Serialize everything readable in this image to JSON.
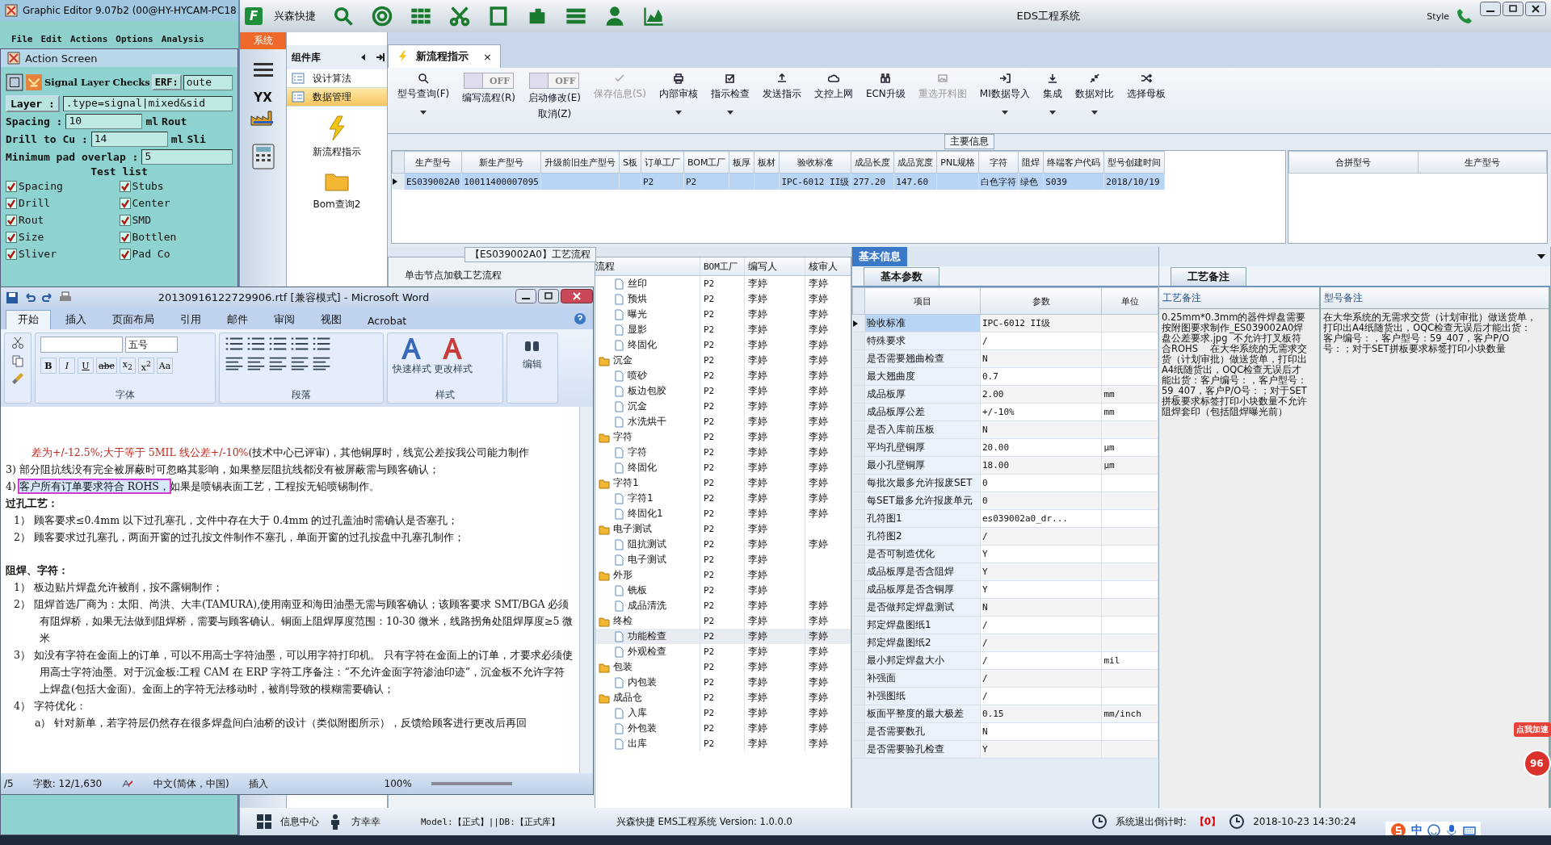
{
  "graphic_editor": {
    "title": "Graphic Editor 9.07b2 (00@HY-HYCAM-PC18",
    "menu": [
      "File",
      "Edit",
      "Actions",
      "Options",
      "Analysis"
    ]
  },
  "action_screen": {
    "title": "Action Screen",
    "heading": "Signal Layer Checks",
    "erf_label": "ERF:",
    "erf_value": "oute",
    "layer_label": "Layer :",
    "layer_value": ".type=signal|mixed&sid",
    "params": [
      {
        "label": "Spacing     :",
        "value": "10",
        "unit": "ml",
        "extra": "Rout"
      },
      {
        "label": "Drill to Cu :",
        "value": "14",
        "unit": "ml",
        "extra": "Sli"
      },
      {
        "label": "Minimum pad overlap :",
        "value": "5"
      }
    ],
    "test_list_title": "Test list",
    "tests": [
      {
        "label": "Spacing",
        "checked": true
      },
      {
        "label": "Stubs",
        "checked": true
      },
      {
        "label": "Drill",
        "checked": true
      },
      {
        "label": "Center",
        "checked": true
      },
      {
        "label": "Rout",
        "checked": true
      },
      {
        "label": "SMD",
        "checked": true
      },
      {
        "label": "Size",
        "checked": true
      },
      {
        "label": "Bottlen",
        "checked": true
      },
      {
        "label": "Sliver",
        "checked": true
      },
      {
        "label": "Pad Co",
        "checked": true
      }
    ]
  },
  "eds": {
    "logo_letter": "F",
    "app_name": "兴森快捷",
    "title": "EDS工程系统",
    "style_menu": "Style",
    "nav": {
      "system_tab": "系统",
      "logo_text": "YX"
    },
    "components": {
      "title": "组件库",
      "items": [
        {
          "label": "设计算法",
          "selected": false
        },
        {
          "label": "数据管理",
          "selected": true
        }
      ],
      "tools": [
        "新流程指示",
        "Bom查询2"
      ]
    },
    "tab": {
      "label": "新流程指示",
      "close": "×"
    },
    "ribbon": [
      {
        "kind": "button",
        "label": "型号查询(F)",
        "disabled": false,
        "dropdown": true
      },
      {
        "kind": "toggle",
        "label": "编写流程(R)",
        "toggle_text": "OFF",
        "on": false
      },
      {
        "kind": "toggle",
        "label": "启动修改(E)",
        "label2": "取消(Z)",
        "toggle_text": "OFF",
        "on": false
      },
      {
        "kind": "button",
        "label": "保存信息(S)",
        "disabled": true,
        "dropdown": false
      },
      {
        "kind": "button",
        "label": "内部审核",
        "disabled": false,
        "dropdown": true
      },
      {
        "kind": "button",
        "label": "指示检查",
        "disabled": false,
        "dropdown": true
      },
      {
        "kind": "button",
        "label": "发送指示",
        "disabled": false,
        "dropdown": false
      },
      {
        "kind": "button",
        "label": "文控上网",
        "disabled": false,
        "dropdown": false
      },
      {
        "kind": "button",
        "label": "ECN升级",
        "disabled": false,
        "dropdown": false
      },
      {
        "kind": "button",
        "label": "重选开料图",
        "disabled": true,
        "dropdown": false
      },
      {
        "kind": "button",
        "label": "MI数据导入",
        "disabled": false,
        "dropdown": true
      },
      {
        "kind": "button",
        "label": "集成",
        "disabled": false,
        "dropdown": true
      },
      {
        "kind": "button",
        "label": "数据对比",
        "disabled": false,
        "dropdown": true
      },
      {
        "kind": "button",
        "label": "选择母板",
        "disabled": false,
        "dropdown": false
      }
    ],
    "main_info": {
      "title": "主要信息",
      "columns": [
        "生产型号",
        "新生产型号",
        "升级前旧生产型号",
        "S板",
        "订单工厂",
        "BOM工厂",
        "板厚",
        "板材",
        "验收标准",
        "成品长度",
        "成品宽度",
        "PNL规格",
        "字符",
        "阻焊",
        "终端客户代码",
        "型号创建时间"
      ],
      "rows": [
        {
          "selected": true,
          "cells": [
            "ES039002A0",
            "10011400007095",
            null,
            null,
            "P2",
            "P2",
            null,
            null,
            "IPC-6012 II级",
            "277.20",
            "147.60",
            null,
            "白色字符",
            "绿色",
            "S039",
            "2018/10/19"
          ]
        }
      ],
      "side_columns": [
        "合拼型号",
        "生产型号"
      ]
    },
    "process": {
      "title": "【ES039002A0】工艺流程",
      "hint": "单击节点加载工艺流程",
      "columns": [
        "流程",
        "BOM工厂",
        "编写人",
        "核审人"
      ],
      "tree": [
        {
          "children": [
            {
              "name": "丝印",
              "bom": "P2",
              "writer": "李婷",
              "reviewer": "李婷",
              "selected": false
            },
            {
              "name": "预烘",
              "bom": "P2",
              "writer": "李婷",
              "reviewer": "李婷",
              "selected": false
            },
            {
              "name": "曝光",
              "bom": "P2",
              "writer": "李婷",
              "reviewer": "李婷",
              "selected": false
            },
            {
              "name": "显影",
              "bom": "P2",
              "writer": "李婷",
              "reviewer": "李婷",
              "selected": false
            },
            {
              "name": "终固化",
              "bom": "P2",
              "writer": "李婷",
              "reviewer": "李婷",
              "selected": false
            }
          ]
        },
        {
          "name": "沉金",
          "bom": "P2",
          "writer": "李婷",
          "reviewer": "李婷",
          "selected": false,
          "children": [
            {
              "name": "喷砂",
              "bom": "P2",
              "writer": "李婷",
              "reviewer": "李婷",
              "selected": false
            },
            {
              "name": "板边包胶",
              "bom": "P2",
              "writer": "李婷",
              "reviewer": "李婷",
              "selected": false
            },
            {
              "name": "沉金",
              "bom": "P2",
              "writer": "李婷",
              "reviewer": "李婷",
              "selected": false
            },
            {
              "name": "水洗烘干",
              "bom": "P2",
              "writer": "李婷",
              "reviewer": "李婷",
              "selected": false
            }
          ]
        },
        {
          "name": "字符",
          "bom": "P2",
          "writer": "李婷",
          "reviewer": "李婷",
          "selected": false,
          "children": [
            {
              "name": "字符",
              "bom": "P2",
              "writer": "李婷",
              "reviewer": "李婷",
              "selected": false
            },
            {
              "name": "终固化",
              "bom": "P2",
              "writer": "李婷",
              "reviewer": "李婷",
              "selected": false
            }
          ]
        },
        {
          "name": "字符1",
          "bom": "P2",
          "writer": "李婷",
          "reviewer": "李婷",
          "selected": false,
          "children": [
            {
              "name": "字符1",
              "bom": "P2",
              "writer": "李婷",
              "reviewer": "李婷",
              "selected": false
            },
            {
              "name": "终固化1",
              "bom": "P2",
              "writer": "李婷",
              "reviewer": "李婷",
              "selected": false
            }
          ]
        },
        {
          "name": "电子测试",
          "bom": "P2",
          "writer": "李婷",
          "selected": false,
          "children": [
            {
              "name": "阻抗测试",
              "bom": "P2",
              "writer": "李婷",
              "reviewer": "李婷",
              "selected": false
            },
            {
              "name": "电子测试",
              "bom": "P2",
              "writer": "李婷",
              "selected": false
            }
          ]
        },
        {
          "name": "外形",
          "bom": "P2",
          "writer": "李婷",
          "selected": false,
          "children": [
            {
              "name": "铣板",
              "bom": "P2",
              "writer": "李婷",
              "selected": false
            },
            {
              "name": "成品清洗",
              "bom": "P2",
              "writer": "李婷",
              "reviewer": "李婷",
              "selected": false
            }
          ]
        },
        {
          "name": "终检",
          "bom": "P2",
          "writer": "李婷",
          "reviewer": "李婷",
          "selected": false,
          "children": [
            {
              "name": "功能检查",
              "bom": "P2",
              "writer": "李婷",
              "reviewer": "李婷",
              "selected": true
            },
            {
              "name": "外观检查",
              "bom": "P2",
              "writer": "李婷",
              "reviewer": "李婷",
              "selected": false
            }
          ]
        },
        {
          "name": "包装",
          "bom": "P2",
          "writer": "李婷",
          "reviewer": "李婷",
          "selected": false,
          "children": [
            {
              "name": "内包装",
              "bom": "P2",
              "writer": "李婷",
              "reviewer": "李婷",
              "selected": false
            }
          ]
        },
        {
          "name": "成品仓",
          "bom": "P2",
          "writer": "李婷",
          "reviewer": "李婷",
          "selected": false,
          "children": [
            {
              "name": "入库",
              "bom": "P2",
              "writer": "李婷",
              "reviewer": "李婷",
              "selected": false
            },
            {
              "name": "外包装",
              "bom": "P2",
              "writer": "李婷",
              "reviewer": "李婷",
              "selected": false
            },
            {
              "name": "出库",
              "bom": "P2",
              "writer": "李婷",
              "reviewer": "李婷",
              "selected": false
            }
          ]
        }
      ]
    },
    "basic_info": {
      "tab": "基本信息",
      "subtab": "基本参数",
      "columns": [
        "项目",
        "参数",
        "单位"
      ],
      "rows": [
        {
          "item": "验收标准",
          "value": "IPC-6012 II级",
          "selected": true
        },
        {
          "item": "特殊要求",
          "value": "/",
          "selected": false
        },
        {
          "item": "是否需要翘曲检查",
          "value": "N",
          "selected": false
        },
        {
          "item": "最大翘曲度",
          "value": "0.7",
          "selected": false
        },
        {
          "item": "成品板厚",
          "value": "2.00",
          "unit": "mm",
          "selected": false
        },
        {
          "item": "成品板厚公差",
          "value": "+/-10%",
          "unit": "mm",
          "selected": false
        },
        {
          "item": "是否入库前压板",
          "value": "N",
          "selected": false
        },
        {
          "item": "平均孔壁铜厚",
          "value": "20.00",
          "unit": "μm",
          "selected": false
        },
        {
          "item": "最小孔壁铜厚",
          "value": "18.00",
          "unit": "μm",
          "selected": false
        },
        {
          "item": "每批次最多允许报废SET",
          "value": "0",
          "selected": false
        },
        {
          "item": "每SET最多允许报废单元",
          "value": "0",
          "selected": false
        },
        {
          "item": "孔符图1",
          "value": "es039002a0_dr...",
          "selected": false
        },
        {
          "item": "孔符图2",
          "value": "/",
          "selected": false
        },
        {
          "item": "是否可制造优化",
          "value": "Y",
          "selected": false
        },
        {
          "item": "成品板厚是否含阻焊",
          "value": "Y",
          "selected": false
        },
        {
          "item": "成品板厚是否含铜厚",
          "value": "Y",
          "selected": false
        },
        {
          "item": "是否做邦定焊盘测试",
          "value": "N",
          "selected": false
        },
        {
          "item": "邦定焊盘图纸1",
          "value": "/",
          "selected": false
        },
        {
          "item": "邦定焊盘图纸2",
          "value": "/",
          "selected": false
        },
        {
          "item": "最小邦定焊盘大小",
          "value": "/",
          "unit": "mil",
          "selected": false
        },
        {
          "item": "补强面",
          "value": "/",
          "selected": false
        },
        {
          "item": "补强图纸",
          "value": "/",
          "selected": false
        },
        {
          "item": "板面平整度的最大极差",
          "value": "0.15",
          "unit": "mm/inch",
          "selected": false
        },
        {
          "item": "是否需要数孔",
          "value": "N",
          "selected": false
        },
        {
          "item": "是否需要验孔检查",
          "value": "Y",
          "selected": false
        }
      ]
    },
    "notes": {
      "subtab": "工艺备注",
      "columns": [
        "工艺备注",
        "型号备注"
      ],
      "process_note": "0.25mm*0.3mm的器件焊盘需要按附图要求制作_ES039002A0焊盘公差要求.jpg  不允许打叉板符合ROHS    在大华系统的无需求交货（计划审批）做送货单，打印出A4纸随货出，OQC检查无误后才能出货：客户编号：，客户型号：59_407，客户P/O号：；对于SET拼板要求标签打印小块数量不允许阻焊套印（包括阻焊曝光前）",
      "model_note": "在大华系统的无需求交货（计划审批）做送货单，打印出A4纸随货出，OQC检查无误后才能出货：客户编号：，客户型号：59_407，客户P/O号：；对于SET拼板要求标签打印小块数量"
    },
    "status": {
      "info_center": "信息中心",
      "user": "方幸幸",
      "model": "Model:【正式】||DB:【正式库】",
      "version": "兴森快捷  EMS工程系统  Version: 1.0.0.0",
      "countdown_label": "系统退出倒计时:",
      "countdown": "【0】",
      "time": "2018-10-23 14:30:24"
    }
  },
  "word": {
    "title": "20130916122729906.rtf [兼容模式] - Microsoft Word",
    "tabs": [
      {
        "label": "开始",
        "selected": true
      },
      {
        "label": "插入",
        "selected": false
      },
      {
        "label": "页面布局",
        "selected": false
      },
      {
        "label": "引用",
        "selected": false
      },
      {
        "label": "邮件",
        "selected": false
      },
      {
        "label": "审阅",
        "selected": false
      },
      {
        "label": "视图",
        "selected": false
      },
      {
        "label": "Acrobat",
        "selected": false
      }
    ],
    "font_size": "五号",
    "font_tools": [
      "B",
      "I",
      "U",
      "abc",
      "x$_{2}$",
      "x$^{2}$",
      "Aa"
    ],
    "groups": [
      "字体",
      "段落",
      "样式"
    ],
    "style_buttons": [
      "快速样式",
      "更改样式"
    ],
    "edit_button": "编辑",
    "paragraphs": [
      {
        "kind": "continued",
        "runs": [
          {
            "text": "差为+/-12.5%;大于等于 5MIL 线公差+/-10%",
            "kind": "revised"
          },
          {
            "text": "(技术中心已评审)，其他铜厚时，线宽公差按我公司能力制作"
          }
        ]
      },
      {
        "kind": "numbered",
        "runs": [
          {
            "text": "3) 部分阻抗线没有完全被屏蔽时可忽略其影响，如果整层阻抗线都没有被屏蔽需与顾客确认；"
          }
        ]
      },
      {
        "kind": "numbered",
        "runs": [
          {
            "text": "4) "
          },
          {
            "text": "客户所有订单要求符合 ROHS，",
            "kind": "marked"
          },
          {
            "text": "如果是喷锡表面工艺，工程按无铅喷锡制作。"
          }
        ]
      },
      {
        "kind": "heading",
        "runs": [
          {
            "text": "过孔工艺："
          }
        ]
      },
      {
        "kind": "list",
        "runs": [
          {
            "text": "1） 顾客要求≤0.4mm 以下过孔塞孔，文件中存在大于 0.4mm 的过孔盖油时需确认是否塞孔；"
          }
        ]
      },
      {
        "kind": "list",
        "runs": [
          {
            "text": "2） 顾客要求过孔塞孔，两面开窗的过孔按文件制作不塞孔，单面开窗的过孔按盘中孔塞孔制作；"
          }
        ]
      },
      {
        "kind": "heading",
        "runs": [
          {
            "text": "阻焊、字符："
          }
        ]
      },
      {
        "kind": "list",
        "runs": [
          {
            "text": "1） 板边贴片焊盘允许被削，按不露铜制作；"
          }
        ]
      },
      {
        "kind": "list",
        "runs": [
          {
            "text": "2） 阻焊首选厂商为：太阳、尚洪、大丰(TAMURA),使用南亚和海田油墨无需与顾客确认；该顾客要求 SMT/BGA 必须有阻焊桥，如果无法做到阻焊桥，需要与顾客确认。铜面上阻焊厚度范围：10-30 微米，线路拐角处阻焊厚度≥5 微米"
          }
        ]
      },
      {
        "kind": "list",
        "runs": [
          {
            "text": "3） 如没有字符在金面上的订单，可以不用高士字符油墨，可以用字符打印机。   只有字符在金面上的订单，才要求必须使用高士字符油墨。对于沉金板:工程 CAM 在 ERP 字符工序备注：“不允许金面字符渗油印迹”，沉金板不允许字符上焊盘(包括大金面)。金面上的字符无法移动时，被削导致的模糊需要确认；"
          }
        ]
      },
      {
        "kind": "list",
        "runs": [
          {
            "text": "4） 字符优化："
          }
        ]
      },
      {
        "kind": "sub",
        "runs": [
          {
            "text": "a） 针对新单，若字符层仍然存在很多焊盘间白油桥的设计（类似附图所示），反馈给顾客进行更改后再回"
          }
        ]
      }
    ],
    "status": {
      "page": "/5",
      "words": "字数: 12/1,630",
      "language": "中文(简体，中国)",
      "mode": "插入",
      "zoom": "100%"
    }
  },
  "widget": {
    "label": "点我加速",
    "value": "96"
  },
  "ime": {
    "mode": "中"
  }
}
